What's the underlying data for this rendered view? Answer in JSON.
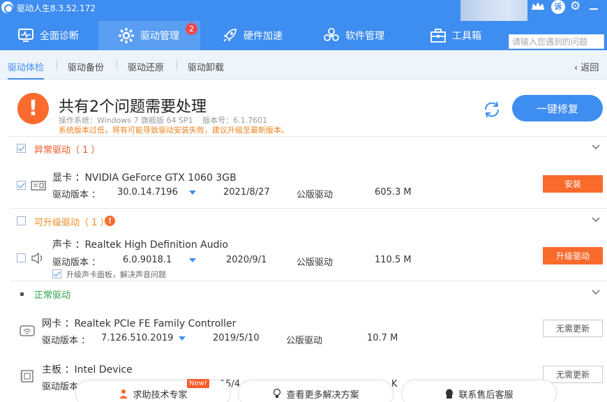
{
  "app": {
    "title": "驱动人生8.3.52.172"
  },
  "nav": {
    "tabs": [
      {
        "label": "全面诊断",
        "icon": "monitor-pulse-icon"
      },
      {
        "label": "驱动管理",
        "icon": "gear-icon",
        "badge": "2"
      },
      {
        "label": "硬件加速",
        "icon": "rocket-icon"
      },
      {
        "label": "软件管理",
        "icon": "apps-icon"
      },
      {
        "label": "工具箱",
        "icon": "toolbox-icon"
      }
    ],
    "search_placeholder": "请输入您遇到的问题"
  },
  "subtabs": [
    "驱动体检",
    "驱动备份",
    "驱动还原",
    "驱动卸载"
  ],
  "back_label": "返回",
  "summary": {
    "title": "共有2个问题需要处理",
    "os": "操作系统：Windows 7 旗舰版  64 SP1",
    "version": "版本号：6.1.7601",
    "warning": "系统版本过低，将有可能导致驱动安装失败，建议升级至最新版本。",
    "fix_button": "一键修复"
  },
  "sections": {
    "abnormal": {
      "title": "异常驱动（ 1 ）"
    },
    "upgradable": {
      "title": "可升级驱动（ 1 ）"
    },
    "normal": {
      "title": "正常驱动"
    }
  },
  "version_label": "驱动版本 ：",
  "devices": [
    {
      "name": "显卡  ：NVIDIA GeForce GTX 1060 3GB",
      "version": "30.0.14.7196",
      "date": "2021/8/27",
      "type": "公版驱动",
      "size": "605.3 M",
      "action": "安装"
    },
    {
      "name": "声卡  ：Realtek High Definition Audio",
      "version": "6.0.9018.1",
      "date": "2020/9/1",
      "type": "公版驱动",
      "size": "110.5 M",
      "action": "升级驱动",
      "hint": "升级声卡面板，解决声音问题"
    },
    {
      "name": "网卡  ：Realtek PCIe FE Family Controller",
      "version": "7.126.510.2019",
      "date": "2019/5/10",
      "type": "公版驱动",
      "size": "10.7 M",
      "action": "无需更新"
    },
    {
      "name": "主板  ：Intel Device",
      "version": "",
      "date": "15/4",
      "type": "",
      "size": "K",
      "action": "无需更新"
    }
  ],
  "bottom": {
    "expert": "求助技术专家",
    "new_tag": "New!",
    "solutions": "查看更多解决方案",
    "service": "联系售后客服"
  },
  "colors": {
    "brand_blue": "#3e8df0",
    "orange": "#f96a2b",
    "green": "#2aa34a"
  }
}
